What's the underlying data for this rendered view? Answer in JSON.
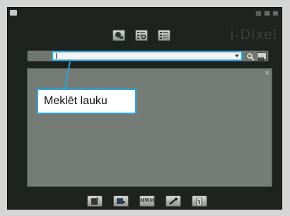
{
  "window": {
    "controls": {
      "minimize": "_",
      "maximize": "□",
      "close": "x"
    }
  },
  "logo": {
    "text": "i-Dixel"
  },
  "toolbar_top": {
    "items": [
      {
        "icon": "patient-add-icon"
      },
      {
        "icon": "search-list-icon"
      },
      {
        "icon": "list-view-icon"
      }
    ]
  },
  "search": {
    "value": "",
    "options_icon": "list-options-icon"
  },
  "results_panel": {
    "close_label": "×"
  },
  "callout": {
    "text": "Meklēt lauku"
  },
  "toolbar_bottom": {
    "items": [
      {
        "icon": "document-icon"
      },
      {
        "icon": "export-icon"
      },
      {
        "label": "MWM"
      },
      {
        "icon": "wrench-icon"
      },
      {
        "icon": "exit-icon"
      }
    ]
  },
  "colors": {
    "accent": "#2aa4da",
    "window_bg": "#1f2320",
    "panel_bg": "#757c76"
  }
}
